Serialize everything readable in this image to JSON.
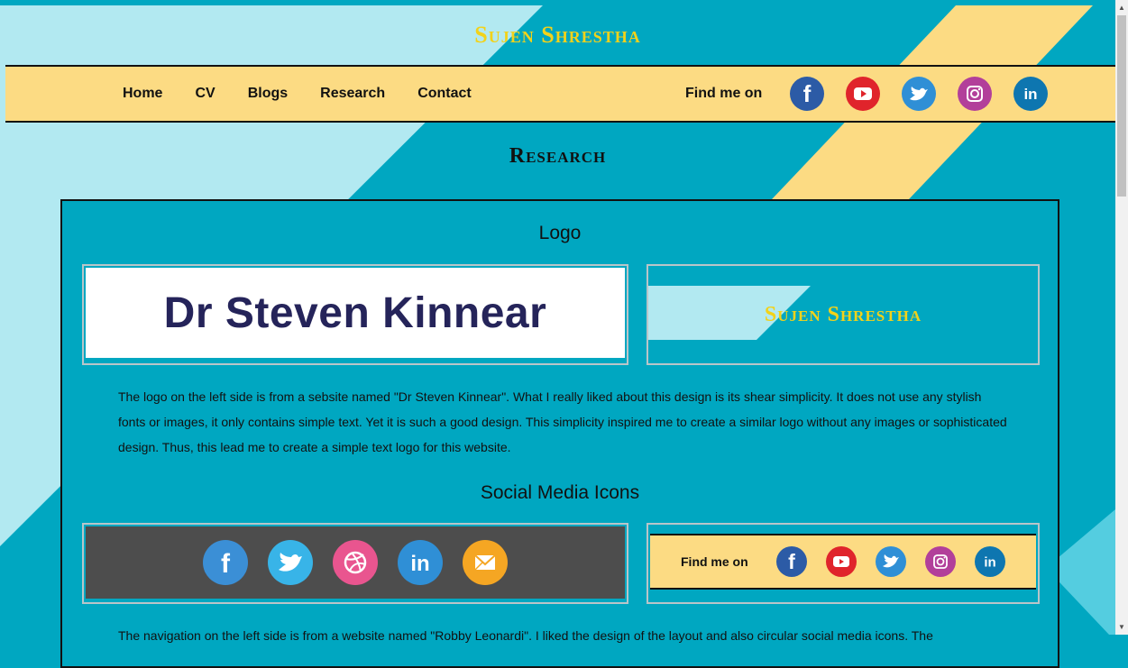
{
  "site": {
    "title": "Sujen Shrestha"
  },
  "nav": {
    "links": [
      "Home",
      "CV",
      "Blogs",
      "Research",
      "Contact"
    ],
    "find_label": "Find me on",
    "social": [
      "facebook-icon",
      "youtube-icon",
      "twitter-icon",
      "instagram-icon",
      "linkedin-icon"
    ]
  },
  "section": {
    "title": "Research"
  },
  "logo_section": {
    "heading": "Logo",
    "example_text": "Dr Steven Kinnear",
    "own_logo_text": "Sujen Shrestha",
    "paragraph": "The logo on the left side is from a sebsite named \"Dr Steven Kinnear\". What I really liked about this design is its shear simplicity. It does not use any stylish fonts or images, it only contains simple text. Yet it is such a good design. This simplicity inspired me to create a similar logo without any images or sophisticated design. Thus, this lead me to create a simple text logo for this website."
  },
  "social_section": {
    "heading": "Social Media Icons",
    "example_icons": [
      "facebook-icon",
      "twitter-icon",
      "dribbble-icon",
      "linkedin-icon",
      "mail-icon"
    ],
    "own_find_label": "Find me on",
    "paragraph": "The navigation on the left side is from a website named \"Robby Leonardi\". I liked the design of the layout and also circular social media icons. The"
  },
  "colors": {
    "background": "#00a7c1",
    "light_stripe": "#b2e9f1",
    "yellow_stripe": "#fcdb83",
    "title_gold": "#f2d21a",
    "facebook": "#2c5ba6",
    "youtube": "#e0242b",
    "twitter": "#2f8fd6",
    "instagram": "#b23f9a",
    "linkedin": "#0e76b0"
  }
}
